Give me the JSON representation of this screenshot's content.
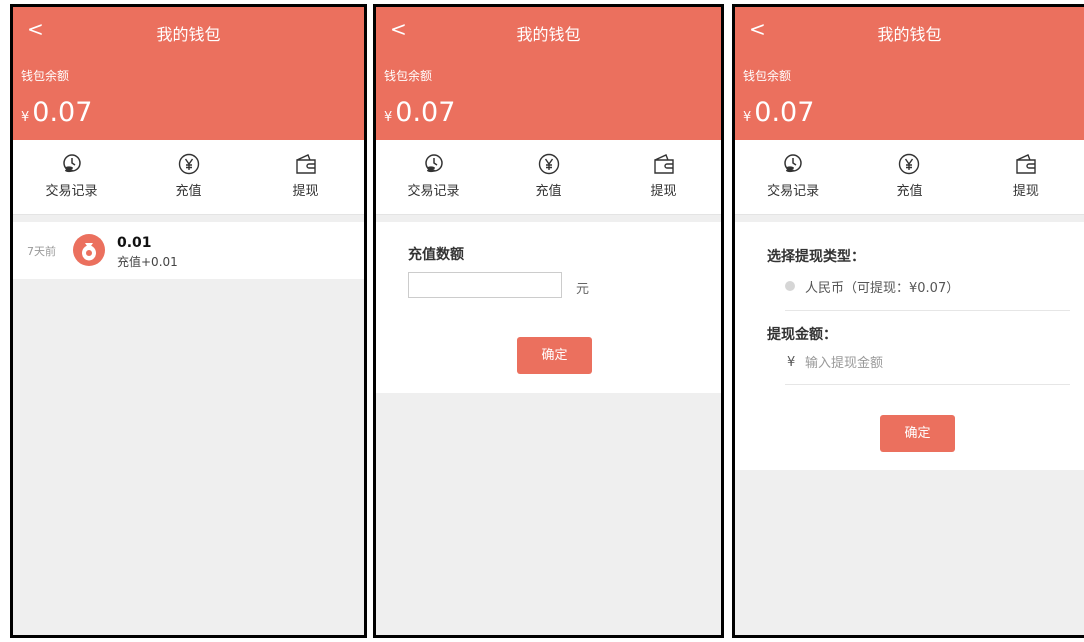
{
  "screens": [
    {
      "header": {
        "back": "<",
        "title": "我的钱包",
        "balance_label": "钱包余额",
        "currency": "¥",
        "balance": "0.07"
      },
      "actions": [
        {
          "icon": "clock-coins-icon",
          "label": "交易记录"
        },
        {
          "icon": "yen-circle-icon",
          "label": "充值"
        },
        {
          "icon": "wallet-icon",
          "label": "提现"
        }
      ],
      "records": [
        {
          "time": "7天前",
          "icon": "money-bag-icon",
          "amount": "0.01",
          "desc": "充值+0.01"
        }
      ]
    },
    {
      "header": {
        "back": "<",
        "title": "我的钱包",
        "balance_label": "钱包余额",
        "currency": "¥",
        "balance": "0.07"
      },
      "actions": [
        {
          "icon": "clock-coins-icon",
          "label": "交易记录"
        },
        {
          "icon": "yen-circle-icon",
          "label": "充值"
        },
        {
          "icon": "wallet-icon",
          "label": "提现"
        }
      ],
      "recharge": {
        "label": "充值数额",
        "value": "",
        "unit": "元",
        "confirm": "确定"
      }
    },
    {
      "header": {
        "back": "<",
        "title": "我的钱包",
        "balance_label": "钱包余额",
        "currency": "¥",
        "balance": "0.07"
      },
      "actions": [
        {
          "icon": "clock-coins-icon",
          "label": "交易记录"
        },
        {
          "icon": "yen-circle-icon",
          "label": "充值"
        },
        {
          "icon": "wallet-icon",
          "label": "提现"
        }
      ],
      "withdraw": {
        "type_label": "选择提现类型：",
        "option": "人民币（可提现：¥0.07）",
        "amount_label": "提现金额：",
        "currency": "¥",
        "placeholder": "输入提现金额",
        "confirm": "确定"
      }
    }
  ]
}
